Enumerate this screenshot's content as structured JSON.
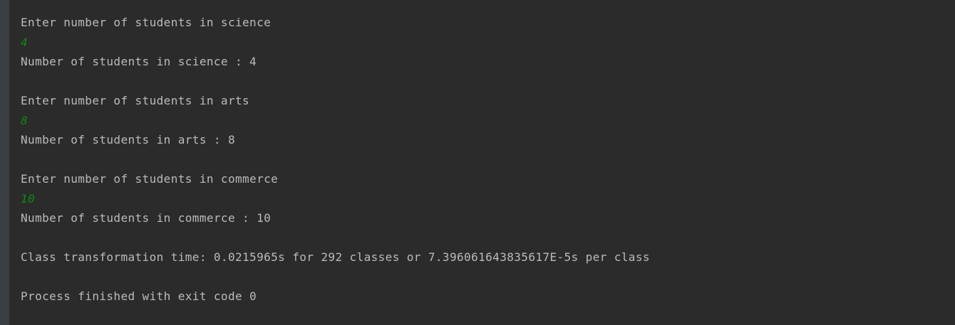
{
  "console": {
    "lines": [
      {
        "kind": "output",
        "text": "Enter number of students in science"
      },
      {
        "kind": "input",
        "text": "4"
      },
      {
        "kind": "output",
        "text": "Number of students in science : 4"
      },
      {
        "kind": "blank",
        "text": ""
      },
      {
        "kind": "output",
        "text": "Enter number of students in arts"
      },
      {
        "kind": "input",
        "text": "8"
      },
      {
        "kind": "output",
        "text": "Number of students in arts : 8"
      },
      {
        "kind": "blank",
        "text": ""
      },
      {
        "kind": "output",
        "text": "Enter number of students in commerce"
      },
      {
        "kind": "input",
        "text": "10"
      },
      {
        "kind": "output",
        "text": "Number of students in commerce : 10"
      },
      {
        "kind": "blank",
        "text": ""
      },
      {
        "kind": "output",
        "text": "Class transformation time: 0.0215965s for 292 classes or 7.396061643835617E-5s per class"
      },
      {
        "kind": "blank",
        "text": ""
      },
      {
        "kind": "output",
        "text": "Process finished with exit code 0"
      }
    ]
  },
  "colors": {
    "background": "#2b2b2b",
    "gutter": "#3c3f41",
    "output_text": "#bbbbbb",
    "user_input_text": "#0f8a0f"
  }
}
